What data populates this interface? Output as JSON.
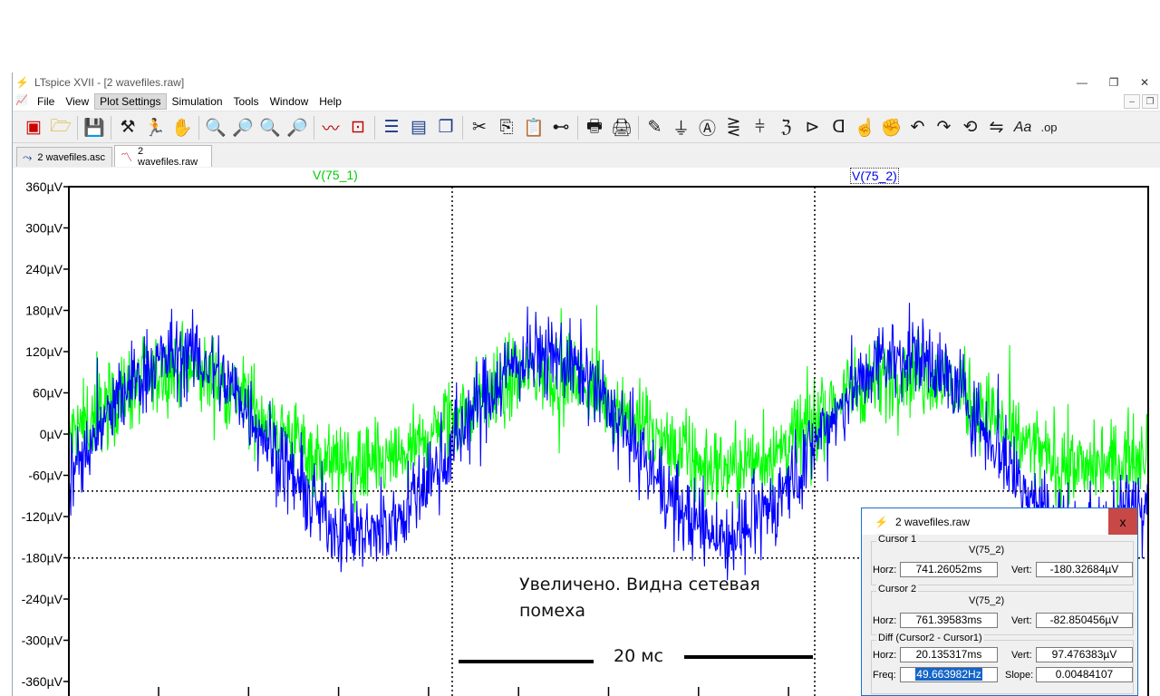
{
  "window": {
    "title": "LTspice XVII - [2 wavefiles.raw]",
    "buttons": [
      "—",
      "❐",
      "✕"
    ]
  },
  "menu": {
    "items": [
      {
        "label": "File",
        "active": false
      },
      {
        "label": "View",
        "active": false
      },
      {
        "label": "Plot Settings",
        "active": true
      },
      {
        "label": "Simulation",
        "active": false
      },
      {
        "label": "Tools",
        "active": false
      },
      {
        "label": "Window",
        "active": false
      },
      {
        "label": "Help",
        "active": false
      }
    ]
  },
  "tabs": [
    {
      "label": "2 wavefiles.asc",
      "icon": "schematic-icon",
      "active": false
    },
    {
      "label": "2 wavefiles.raw",
      "icon": "waveform-icon",
      "active": true
    }
  ],
  "plot": {
    "trace1_label": "V(75_1)",
    "trace2_label": "V(75_2)",
    "trace1_color": "#00ff00",
    "trace2_color": "#0000ff",
    "ytick_labels": [
      "360µV",
      "300µV",
      "240µV",
      "180µV",
      "120µV",
      "60µV",
      "0µV",
      "-60µV",
      "-120µV",
      "-180µV",
      "-240µV",
      "-300µV",
      "-360µV"
    ],
    "annotation_line1": "Увеличено. Видна сетевая",
    "annotation_line2": "помеха",
    "scale_label": "20 мс"
  },
  "chart_data": {
    "type": "line",
    "title": "",
    "xlabel": "",
    "ylabel": "",
    "ylim": [
      -360,
      360
    ],
    "y_unit": "µV",
    "grid": false,
    "cursor_lines_y": [
      -180.32684,
      -82.850456
    ],
    "series": [
      {
        "name": "V(75_1)",
        "color": "#00ff00",
        "frequency_hz": 49.66,
        "offset_uv": 20,
        "amplitude_uv": 70,
        "noise_uv": 55
      },
      {
        "name": "V(75_2)",
        "color": "#0000ff",
        "frequency_hz": 49.66,
        "offset_uv": -15,
        "amplitude_uv": 130,
        "noise_uv": 55
      }
    ]
  },
  "cursor_window": {
    "title": "2 wavefiles.raw",
    "close": "x",
    "cursor1": {
      "label": "Cursor 1",
      "trace": "V(75_2)",
      "horz_label": "Horz:",
      "horz": "741.26052ms",
      "vert_label": "Vert:",
      "vert": "-180.32684µV"
    },
    "cursor2": {
      "label": "Cursor 2",
      "trace": "V(75_2)",
      "horz_label": "Horz:",
      "horz": "761.39583ms",
      "vert_label": "Vert:",
      "vert": "-82.850456µV"
    },
    "diff": {
      "label": "Diff (Cursor2 - Cursor1)",
      "horz_label": "Horz:",
      "horz": "20.135317ms",
      "vert_label": "Vert:",
      "vert": "97.476383µV",
      "freq_label": "Freq:",
      "freq": "49.663982Hz",
      "slope_label": "Slope:",
      "slope": "0.00484107"
    }
  }
}
